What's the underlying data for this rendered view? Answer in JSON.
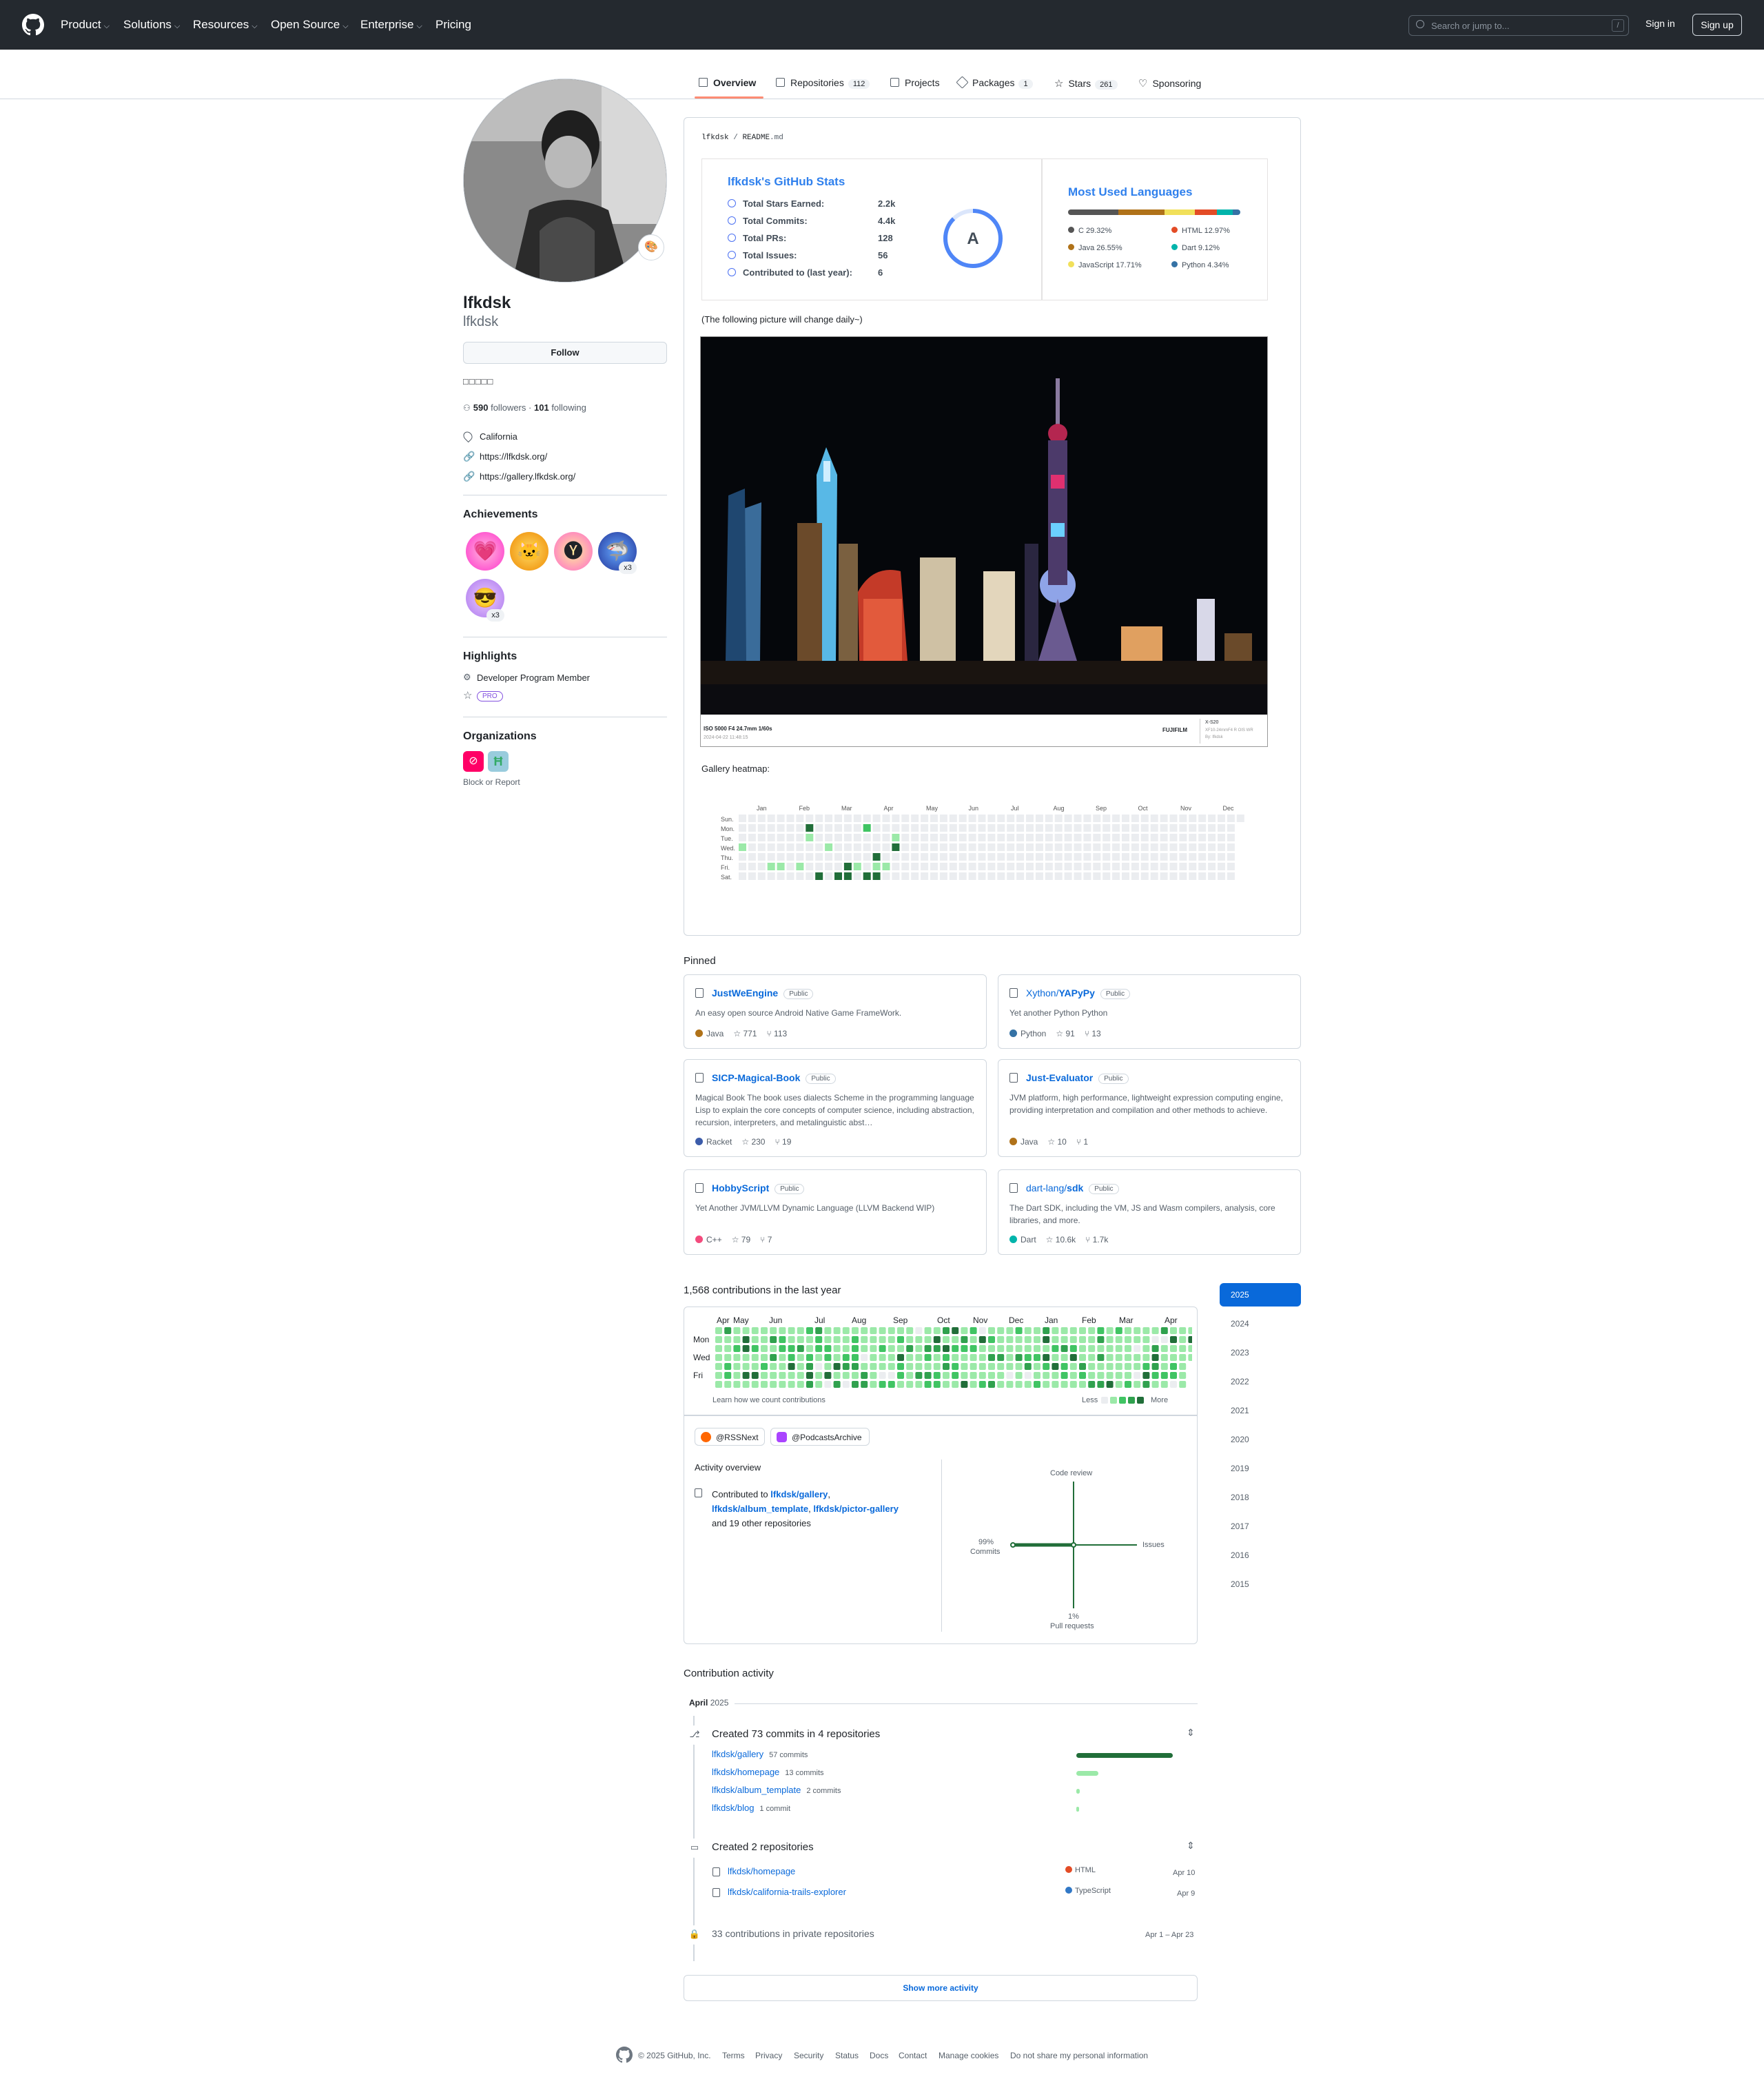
{
  "header": {
    "nav": [
      "Product",
      "Solutions",
      "Resources",
      "Open Source",
      "Enterprise",
      "Pricing"
    ],
    "search_placeholder": "Search or jump to...",
    "search_shortcut": "/",
    "sign_in": "Sign in",
    "sign_up": "Sign up"
  },
  "tabs": [
    {
      "label": "Overview",
      "count": ""
    },
    {
      "label": "Repositories",
      "count": "112"
    },
    {
      "label": "Projects",
      "count": ""
    },
    {
      "label": "Packages",
      "count": "1"
    },
    {
      "label": "Stars",
      "count": "261"
    },
    {
      "label": "Sponsoring",
      "count": ""
    }
  ],
  "profile": {
    "name": "lfkdsk",
    "login": "lfkdsk",
    "follow": "Follow",
    "bio": "□□□□□",
    "followers": "590",
    "followers_label": "followers",
    "following": "101",
    "following_label": "following",
    "sep": "·",
    "location": "California",
    "link1": "https://lfkdsk.org/",
    "link2": "https://gallery.lfkdsk.org/",
    "achievements_title": "Achievements",
    "achievement_counts": [
      "x3",
      "x3"
    ],
    "highlights_title": "Highlights",
    "highlight1": "Developer Program Member",
    "pro_badge": "PRO",
    "organizations_title": "Organizations",
    "block": "Block or Report"
  },
  "readme": {
    "breadcrumb_user": "lfkdsk",
    "breadcrumb_sep": "/",
    "breadcrumb_file": "README",
    "breadcrumb_ext": ".md",
    "stats_title": "lfkdsk's GitHub Stats",
    "stats": [
      {
        "label": "Total Stars Earned:",
        "value": "2.2k"
      },
      {
        "label": "Total Commits:",
        "value": "4.4k"
      },
      {
        "label": "Total PRs:",
        "value": "128"
      },
      {
        "label": "Total Issues:",
        "value": "56"
      },
      {
        "label": "Contributed to (last year):",
        "value": "6"
      }
    ],
    "grade": "A",
    "langs_title": "Most Used Languages",
    "langs": [
      {
        "name": "C 29.32%",
        "color": "#555555",
        "pct": 29.32
      },
      {
        "name": "HTML 12.97%",
        "color": "#e34c26",
        "pct": 12.97
      },
      {
        "name": "Java 26.55%",
        "color": "#b07219",
        "pct": 26.55
      },
      {
        "name": "Dart 9.12%",
        "color": "#00b4ab",
        "pct": 9.12
      },
      {
        "name": "JavaScript 17.71%",
        "color": "#f1e05a",
        "pct": 17.71
      },
      {
        "name": "Python 4.34%",
        "color": "#3572a5",
        "pct": 4.34
      }
    ],
    "daily_note": "(The following picture will change daily~)",
    "photo_exif": "ISO 5000 F4 24.7mm 1/60s",
    "photo_date": "2024-04-22 11:48:15",
    "photo_brand": "FUJIFILM",
    "photo_model": "X-S20",
    "photo_lens": "XF10-24mmF4 R OIS WR",
    "photo_by": "By: lfkdsk",
    "gallery_title": "Gallery heatmap:",
    "gallery_months": [
      "Jan",
      "Feb",
      "Mar",
      "Apr",
      "May",
      "Jun",
      "Jul",
      "Aug",
      "Sep",
      "Oct",
      "Nov",
      "Dec"
    ],
    "gallery_days": [
      "Sun",
      "Mon",
      "Tue",
      "Wed",
      "Thu",
      "Fri",
      "Sat"
    ]
  },
  "pinned": {
    "title": "Pinned",
    "public": "Public",
    "cards": [
      {
        "owner": "",
        "name": "JustWeEngine",
        "desc": "An easy open source Android Native Game FrameWork.",
        "lang": "Java",
        "color": "#b07219",
        "stars": "771",
        "forks": "113"
      },
      {
        "owner": "Xython/",
        "name": "YAPyPy",
        "desc": "Yet another Python Python",
        "lang": "Python",
        "color": "#3572a5",
        "stars": "91",
        "forks": "13"
      },
      {
        "owner": "",
        "name": "SICP-Magical-Book",
        "desc": "Magical Book The book uses dialects Scheme in the programming language Lisp to explain the core concepts of computer science, including abstraction, recursion, interpreters, and metalinguistic abst…",
        "lang": "Racket",
        "color": "#3c5caa",
        "stars": "230",
        "forks": "19"
      },
      {
        "owner": "",
        "name": "Just-Evaluator",
        "desc": "JVM platform, high performance, lightweight expression computing engine, providing interpretation and compilation and other methods to achieve.",
        "lang": "Java",
        "color": "#b07219",
        "stars": "10",
        "forks": "1"
      },
      {
        "owner": "",
        "name": "HobbyScript",
        "desc": "Yet Another JVM/LLVM Dynamic Language (LLVM Backend WIP)",
        "lang": "C++",
        "color": "#f34b7d",
        "stars": "79",
        "forks": "7"
      },
      {
        "owner": "dart-lang/",
        "name": "sdk",
        "desc": "The Dart SDK, including the VM, JS and Wasm compilers, analysis, core libraries, and more.",
        "lang": "Dart",
        "color": "#00b4ab",
        "stars": "10.6k",
        "forks": "1.7k"
      }
    ]
  },
  "contributions": {
    "title": "1,568 contributions in the last year",
    "months": [
      "Apr",
      "May",
      "Jun",
      "Jul",
      "Aug",
      "Sep",
      "Oct",
      "Nov",
      "Dec",
      "Jan",
      "Feb",
      "Mar",
      "Apr"
    ],
    "days": [
      "Mon",
      "Wed",
      "Fri"
    ],
    "learn": "Learn how we count contributions",
    "less": "Less",
    "more": "More",
    "orgs": [
      "@RSSNext",
      "@PodcastsArchive"
    ],
    "years": [
      "2025",
      "2024",
      "2023",
      "2022",
      "2021",
      "2020",
      "2019",
      "2018",
      "2017",
      "2016",
      "2015"
    ],
    "overview_title": "Activity overview",
    "contributed_prefix": "Contributed to",
    "contributed_repos": [
      "lfkdsk/gallery",
      "lfkdsk/album_template",
      "lfkdsk/pictor-gallery"
    ],
    "contributed_suffix": "and 19 other repositories",
    "axis_code_review": "Code review",
    "axis_issues": "Issues",
    "axis_commits_pct": "99%",
    "axis_commits": "Commits",
    "axis_prs_pct": "1%",
    "axis_prs": "Pull requests"
  },
  "activity": {
    "title": "Contribution activity",
    "month": "April",
    "year": "2025",
    "commits_title": "Created 73 commits in 4 repositories",
    "commit_repos": [
      {
        "name": "lfkdsk/gallery",
        "count": "57 commits",
        "n": 57
      },
      {
        "name": "lfkdsk/homepage",
        "count": "13 commits",
        "n": 13
      },
      {
        "name": "lfkdsk/album_template",
        "count": "2 commits",
        "n": 2
      },
      {
        "name": "lfkdsk/blog",
        "count": "1 commit",
        "n": 1
      }
    ],
    "repos_title": "Created 2 repositories",
    "created": [
      {
        "name": "lfkdsk/homepage",
        "lang": "HTML",
        "color": "#e34c26",
        "date": "Apr 10"
      },
      {
        "name": "lfkdsk/california-trails-explorer",
        "lang": "TypeScript",
        "color": "#3178c6",
        "date": "Apr 9"
      }
    ],
    "private": "33 contributions in private repositories",
    "private_range": "Apr 1 – Apr 23",
    "show_more": "Show more activity"
  },
  "footer": {
    "copyright": "© 2025 GitHub, Inc.",
    "links": [
      "Terms",
      "Privacy",
      "Security",
      "Status",
      "Docs",
      "Contact",
      "Manage cookies",
      "Do not share my personal information"
    ]
  }
}
